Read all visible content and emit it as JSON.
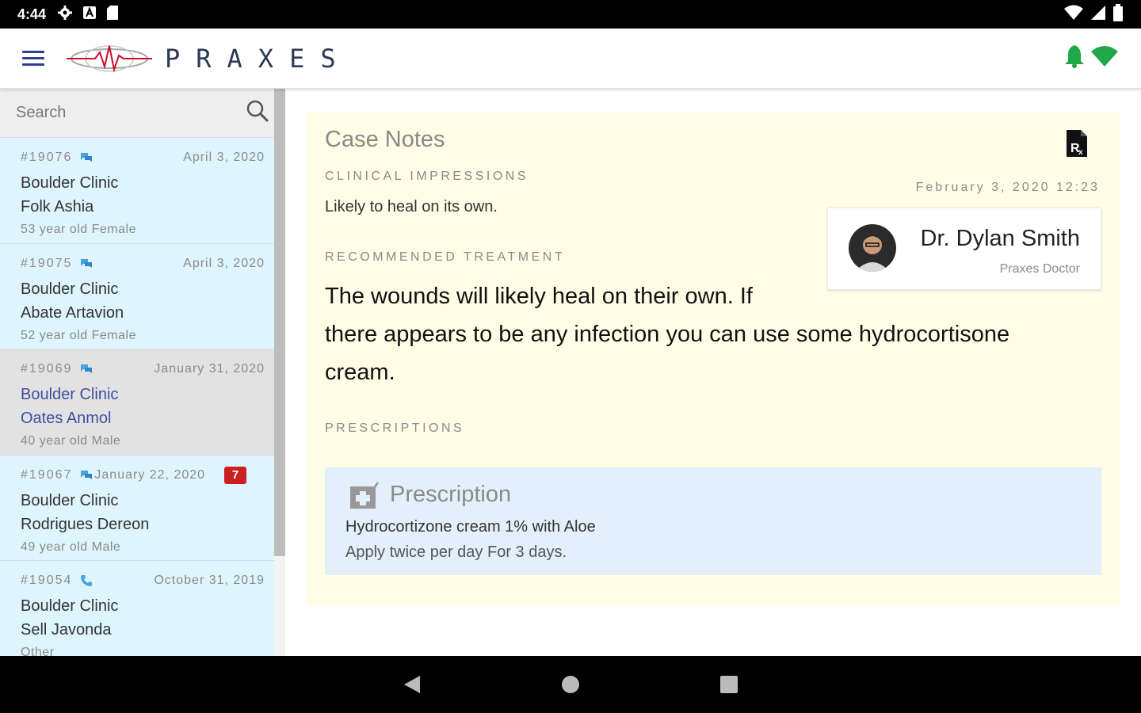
{
  "status_bar": {
    "time": "4:44",
    "left_icons": [
      "gear-icon",
      "a-icon",
      "sd-card-icon"
    ],
    "right_icons": [
      "wifi-icon",
      "signal-icon",
      "battery-icon"
    ]
  },
  "app_bar": {
    "brand": "PRAXES",
    "right_icons": [
      "bell-icon",
      "wifi-status-icon"
    ],
    "accent_color": "#1ea84a"
  },
  "sidebar": {
    "search_placeholder": "Search",
    "cases": [
      {
        "id": "#19076",
        "comm": "chat-icon",
        "date": "April 3, 2020",
        "clinic": "Boulder Clinic",
        "patient": "Folk Ashia",
        "meta": "53 year old Female",
        "badge": "",
        "selected": false
      },
      {
        "id": "#19075",
        "comm": "chat-icon",
        "date": "April 3, 2020",
        "clinic": "Boulder Clinic",
        "patient": "Abate Artavion",
        "meta": "52 year old Female",
        "badge": "",
        "selected": false
      },
      {
        "id": "#19069",
        "comm": "chat-icon",
        "date": "January 31, 2020",
        "clinic": "Boulder Clinic",
        "patient": "Oates Anmol",
        "meta": "40 year old Male",
        "badge": "",
        "selected": true
      },
      {
        "id": "#19067",
        "comm": "chat-icon",
        "date": "January 22, 2020",
        "clinic": "Boulder Clinic",
        "patient": "Rodrigues Dereon",
        "meta": "49 year old Male",
        "badge": "7",
        "selected": false
      },
      {
        "id": "#19054",
        "comm": "phone-icon",
        "date": "October 31, 2019",
        "clinic": "Boulder Clinic",
        "patient": "Sell Javonda",
        "meta": "Other",
        "badge": "",
        "selected": false
      }
    ]
  },
  "notes": {
    "title": "Case Notes",
    "clinical_label": "CLINICAL IMPRESSIONS",
    "clinical_text": "Likely to heal on its own.",
    "timestamp": "February 3, 2020 12:23",
    "doctor": {
      "name": "Dr. Dylan Smith",
      "role": "Praxes Doctor"
    },
    "treatment_label": "RECOMMENDED TREATMENT",
    "treatment_line1": "The wounds will likely heal on their own. If",
    "treatment_line2": "there appears to be any infection you can use some hydrocortisone",
    "treatment_line3": "cream.",
    "prescriptions_label": "PRESCRIPTIONS",
    "prescription": {
      "title": "Prescription",
      "medication": "Hydrocortizone cream 1% with Aloe",
      "directions": "Apply twice per day For 3 days."
    }
  },
  "nav_bar": {
    "buttons": [
      "back-icon",
      "home-icon",
      "recents-icon"
    ]
  }
}
